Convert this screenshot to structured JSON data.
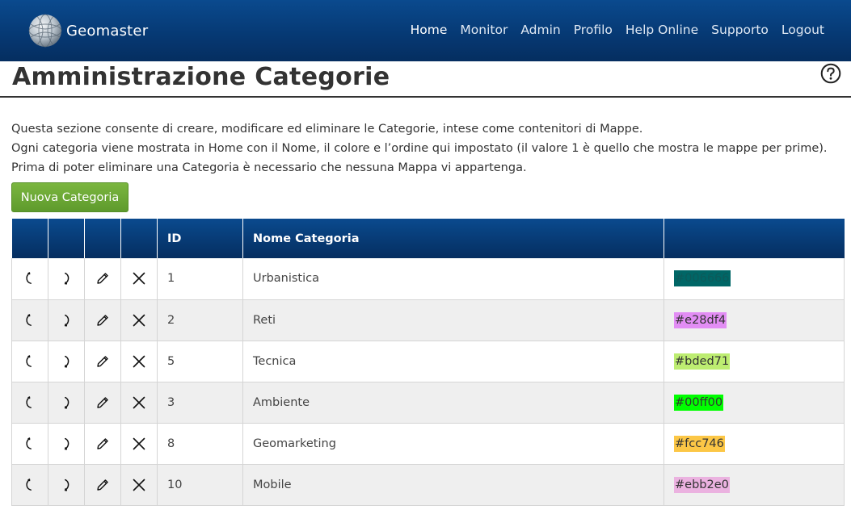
{
  "brand": {
    "name": "Geomaster"
  },
  "nav": {
    "items": [
      {
        "label": "Home",
        "active": true
      },
      {
        "label": "Monitor"
      },
      {
        "label": "Admin"
      },
      {
        "label": "Profilo"
      },
      {
        "label": "Help Online"
      },
      {
        "label": "Supporto"
      },
      {
        "label": "Logout"
      }
    ]
  },
  "page": {
    "title": "Amministrazione Categorie",
    "help_icon": "question-circle-icon",
    "description": [
      "Questa sezione consente di creare, modificare ed eliminare le Categorie, intese come contenitori di Mappe.",
      "Ogni categoria viene mostrata in Home con il Nome, il colore e l’ordine qui impostato (il valore 1 è quello che mostra le mappe per prime).",
      "Prima di poter eliminare una Categoria è necessario che nessuna Mappa vi appartenga."
    ],
    "new_button": "Nuova Categoria"
  },
  "colors": {
    "nav_bg": "#063872",
    "button_green": "#6aa834"
  },
  "table": {
    "headers": [
      "",
      "",
      "",
      "",
      "ID",
      "Nome Categoria",
      ""
    ],
    "action_icons": [
      "move-up-icon",
      "move-down-icon",
      "edit-pencil-icon",
      "delete-x-icon"
    ],
    "rows": [
      {
        "id": "1",
        "name": "Urbanistica",
        "color": "#006666"
      },
      {
        "id": "2",
        "name": "Reti",
        "color": "#e28df4"
      },
      {
        "id": "5",
        "name": "Tecnica",
        "color": "#bded71"
      },
      {
        "id": "3",
        "name": "Ambiente",
        "color": "#00ff00"
      },
      {
        "id": "8",
        "name": "Geomarketing",
        "color": "#fcc746"
      },
      {
        "id": "10",
        "name": "Mobile",
        "color": "#ebb2e0"
      }
    ]
  }
}
